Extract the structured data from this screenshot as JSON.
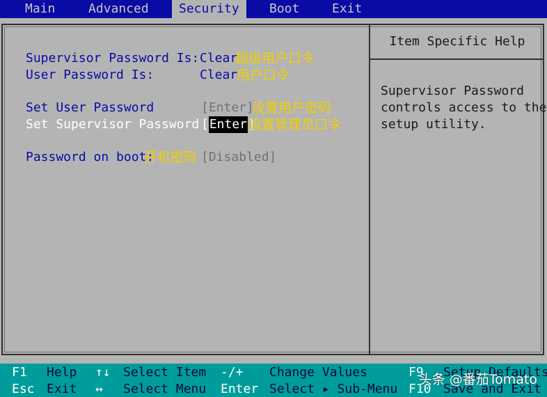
{
  "menu": {
    "items": [
      {
        "label": "Main"
      },
      {
        "label": "Advanced"
      },
      {
        "label": "Security"
      },
      {
        "label": "Boot"
      },
      {
        "label": "Exit"
      }
    ],
    "active": "Security"
  },
  "settings": {
    "supervisor_status": {
      "label": "Supervisor Password Is:",
      "value": "Clear",
      "annotation": "超级用户口令"
    },
    "user_status": {
      "label": "User Password Is:",
      "value": "Clear",
      "annotation": "用户口令"
    },
    "set_user": {
      "label": "Set User Password",
      "value": "[Enter]",
      "annotation": "设置用户密码"
    },
    "set_supervisor": {
      "label": "Set Supervisor Password",
      "value_open": "[",
      "value_highlight": "Enter",
      "value_close": "]",
      "annotation": "设置管理员口令"
    },
    "password_on_boot": {
      "label": "Password on boot:",
      "annotation": "开机密码",
      "value": "[Disabled]"
    }
  },
  "help": {
    "title": "Item Specific Help",
    "lines": [
      "Supervisor Password",
      "controls access to the",
      "setup utility."
    ]
  },
  "footer": {
    "row1": [
      {
        "key": "F1",
        "desc": "Help"
      },
      {
        "key": "↑↓",
        "desc": "Select Item"
      },
      {
        "key": "-/+",
        "desc": "Change Values"
      },
      {
        "key": "F9",
        "desc": "Setup Defaults"
      }
    ],
    "row2": [
      {
        "key": "Esc",
        "desc": "Exit"
      },
      {
        "key": "↔",
        "desc": "Select Menu"
      },
      {
        "key": "Enter",
        "desc": "Select ▸ Sub-Menu"
      },
      {
        "key": "F10",
        "desc": "Save and Exit"
      }
    ]
  },
  "watermark": "头条 @番茄Tomato",
  "colors": {
    "menu_bg": "#0a0aa4",
    "panel_bg": "#b4b4b4",
    "footer_bg": "#009c9c",
    "annotation": "#f0d000"
  }
}
